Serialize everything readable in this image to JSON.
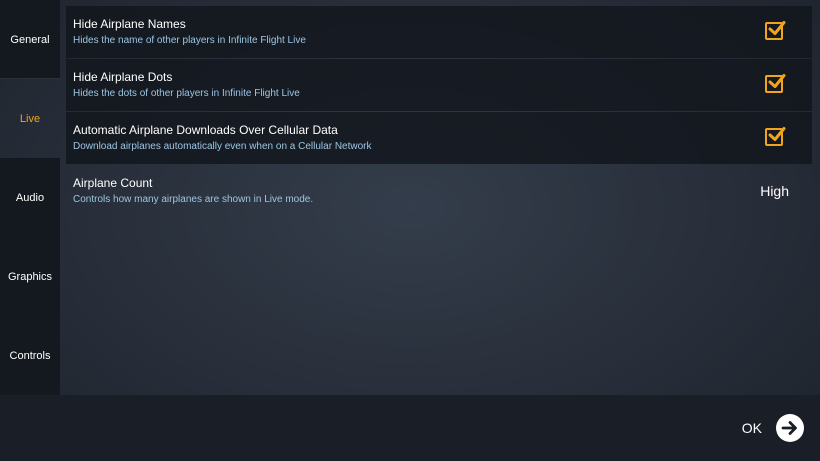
{
  "sidebar": {
    "tabs": [
      {
        "label": "General",
        "selected": false
      },
      {
        "label": "Live",
        "selected": true
      },
      {
        "label": "Audio",
        "selected": false
      },
      {
        "label": "Graphics",
        "selected": false
      },
      {
        "label": "Controls",
        "selected": false
      }
    ]
  },
  "settings": [
    {
      "title": "Hide Airplane Names",
      "description": "Hides the name of other players in Infinite Flight Live",
      "checked": true
    },
    {
      "title": "Hide Airplane Dots",
      "description": "Hides the dots of other players in Infinite Flight Live",
      "checked": true
    },
    {
      "title": "Automatic Airplane Downloads Over Cellular Data",
      "description": "Download airplanes automatically even when on a Cellular Network",
      "checked": true
    },
    {
      "title": "Airplane Count",
      "description": "Controls how many airplanes are shown in Live mode.",
      "value": "High"
    }
  ],
  "footer": {
    "ok_label": "OK",
    "ok_icon": "arrow-right-circle-icon"
  },
  "colors": {
    "accent": "#f2a51a",
    "description_text": "#9cc6e2"
  }
}
